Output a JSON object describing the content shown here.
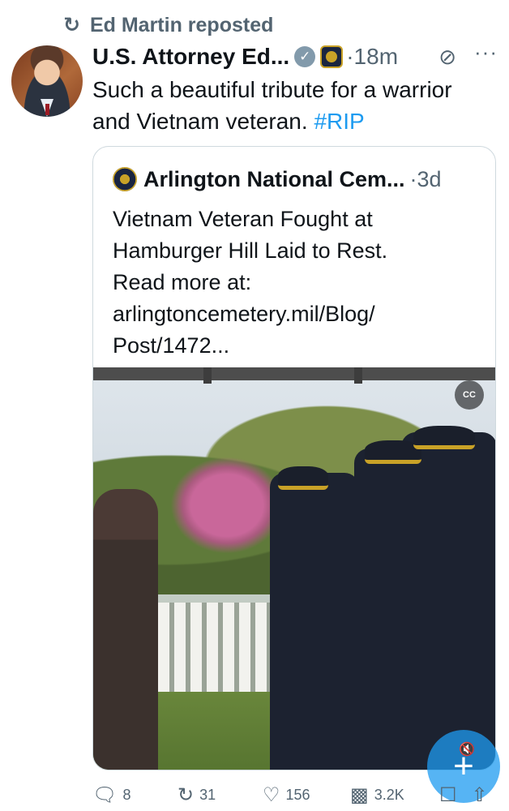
{
  "repost": {
    "icon": "repost-icon",
    "label": "Ed Martin reposted"
  },
  "post": {
    "author": "U.S. Attorney Ed...",
    "time": "·18m",
    "text": "Such a beautiful tribute for a warrior and Vietnam veteran.",
    "hashtag": "#RIP",
    "icons": [
      "avatar",
      "verified-icon",
      "org-badge-icon",
      "grok-icon",
      "more-icon"
    ]
  },
  "quote": {
    "author": "Arlington National Cem...",
    "time": "·3d",
    "text_lines": [
      "Vietnam Veteran Fought at",
      "Hamburger Hill Laid to Rest.",
      "Read more at:",
      "arlingtoncemetery.mil/Blog/",
      "Post/1472..."
    ],
    "video_caption_icon": "CC"
  },
  "actions": {
    "replies": "8",
    "reposts": "31",
    "likes": "156",
    "views": "3.2K"
  },
  "colors": {
    "accent": "#1d9bf0",
    "muted": "#536471",
    "text": "#0f1419"
  }
}
